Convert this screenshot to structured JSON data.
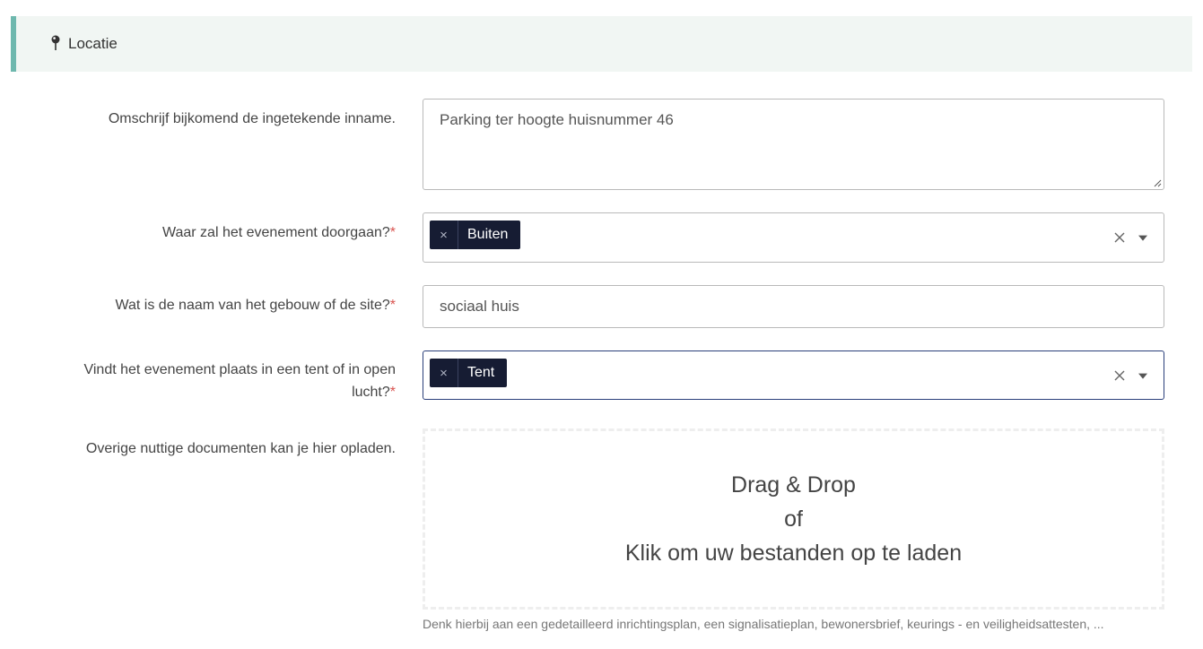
{
  "section": {
    "title": "Locatie",
    "icon": "map-pin-icon",
    "accent_color": "#6eb8ae",
    "background_color": "#f1f6f3"
  },
  "fields": {
    "description": {
      "label": "Omschrijf bijkomend de ingetekende inname.",
      "value": "Parking ter hoogte huisnummer 46"
    },
    "location_type": {
      "label": "Waar zal het evenement doorgaan?",
      "required_mark": "*",
      "selected": "Buiten"
    },
    "site_name": {
      "label": "Wat is de naam van het gebouw of de site?",
      "required_mark": "*",
      "value": "sociaal huis"
    },
    "tent_or_open_air": {
      "label_line1": "Vindt het evenement plaats in een tent of in open",
      "label_line2": "lucht?",
      "required_mark": "*",
      "selected": "Tent"
    },
    "documents": {
      "label": "Overige nuttige documenten kan je hier opladen.",
      "dropzone_line1": "Drag & Drop",
      "dropzone_line2": "of",
      "dropzone_line3": "Klik om uw bestanden op te laden",
      "help_text": "Denk hierbij aan een gedetailleerd inrichtingsplan, een signalisatieplan, bewonersbrief, keurings - en veiligheidsattesten, ..."
    }
  },
  "chip_remove_glyph": "×",
  "colors": {
    "chip_background": "#161c33",
    "required": "#d9534f",
    "focus_border": "#2a3f7a"
  }
}
